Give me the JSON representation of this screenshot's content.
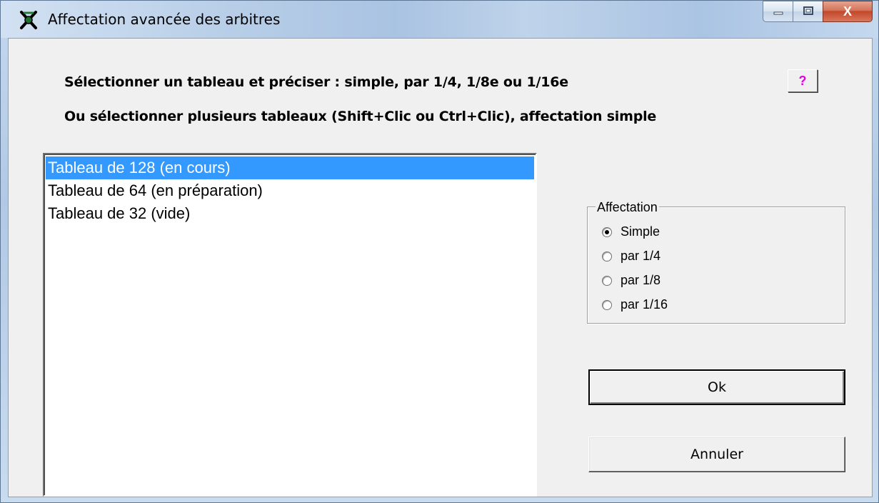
{
  "window": {
    "title": "Affectation avancée des arbitres",
    "icon": "crossed-whistle-icon",
    "caption_buttons": {
      "minimize": "minimize-icon",
      "maximize": "maximize-icon",
      "close_label": "X"
    }
  },
  "instructions": {
    "line1": "Sélectionner un tableau et préciser : simple, par 1/4, 1/8e ou 1/16e",
    "line2": "Ou sélectionner plusieurs tableaux (Shift+Clic ou Ctrl+Clic), affectation simple"
  },
  "help_button": {
    "label": "?"
  },
  "tableaux_list": {
    "items": [
      {
        "label": "Tableau de 128 (en cours)",
        "selected": true
      },
      {
        "label": "Tableau de 64 (en préparation)",
        "selected": false
      },
      {
        "label": "Tableau de 32 (vide)",
        "selected": false
      }
    ]
  },
  "affectation": {
    "legend": "Affectation",
    "options": [
      {
        "label": "Simple",
        "checked": true
      },
      {
        "label": "par 1/4",
        "checked": false
      },
      {
        "label": "par 1/8",
        "checked": false
      },
      {
        "label": "par 1/16",
        "checked": false
      }
    ]
  },
  "buttons": {
    "ok_label": "Ok",
    "cancel_label": "Annuler"
  },
  "colors": {
    "selection": "#3399ff",
    "help_question_mark": "#e000e0",
    "dialog_background": "#f0f0f0"
  }
}
